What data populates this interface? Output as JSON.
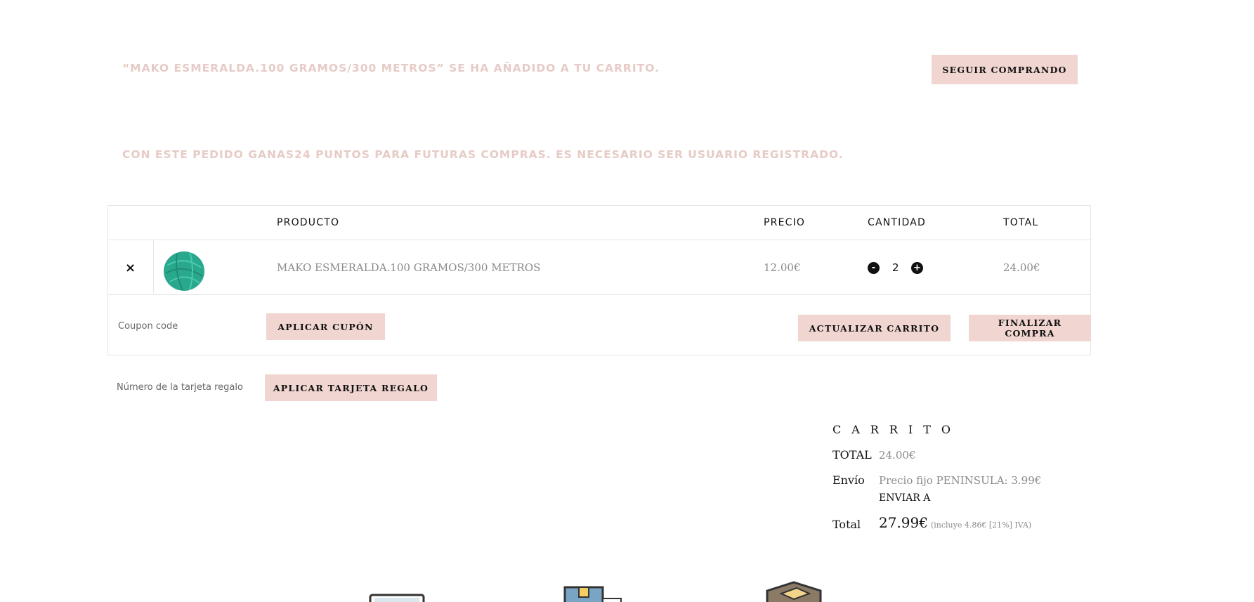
{
  "notices": {
    "added": "“MAKO ESMERALDA.100 GRAMOS/300 METROS” SE HA AÑADIDO A TU CARRITO.",
    "continue_label": "SEGUIR COMPRANDO",
    "points": "CON ESTE PEDIDO GANAS24 PUNTOS PARA FUTURAS COMPRAS. ES NECESARIO SER USUARIO REGISTRADO."
  },
  "table": {
    "headers": {
      "product": "PRODUCTO",
      "price": "PRECIO",
      "quantity": "CANTIDAD",
      "total": "TOTAL"
    },
    "rows": [
      {
        "remove": "×",
        "name": "MAKO ESMERALDA.100 GRAMOS/300 METROS",
        "price": "12.00€",
        "qty_minus": "-",
        "qty": "2",
        "qty_plus": "+",
        "total": "24.00€"
      }
    ]
  },
  "actions": {
    "coupon_placeholder": "Coupon code",
    "apply_coupon": "APLICAR CUPÓN",
    "update_cart": "ACTUALIZAR CARRITO",
    "checkout": "FINALIZAR COMPRA",
    "giftcard_placeholder": "Número de la tarjeta regalo",
    "apply_giftcard": "APLICAR TARJETA REGALO"
  },
  "totals": {
    "heading": "CARRITO",
    "subtotal_label": "TOTAL",
    "subtotal_value": "24.00€",
    "shipping_label": "Envío",
    "shipping_value": "Precio fijo PENINSULA: 3.99€",
    "ship_to": "ENVIAR A",
    "total_label": "Total",
    "total_value": "27.99€",
    "tax_note": "(incluye 4.86€ [21%] IVA)"
  },
  "icons": [
    "laptop-icon",
    "package-icon",
    "open-box-icon"
  ],
  "colors": {
    "accent": "#f0d5d0",
    "notice_text": "#e6cbc6",
    "yarn": "#2aa88e"
  }
}
